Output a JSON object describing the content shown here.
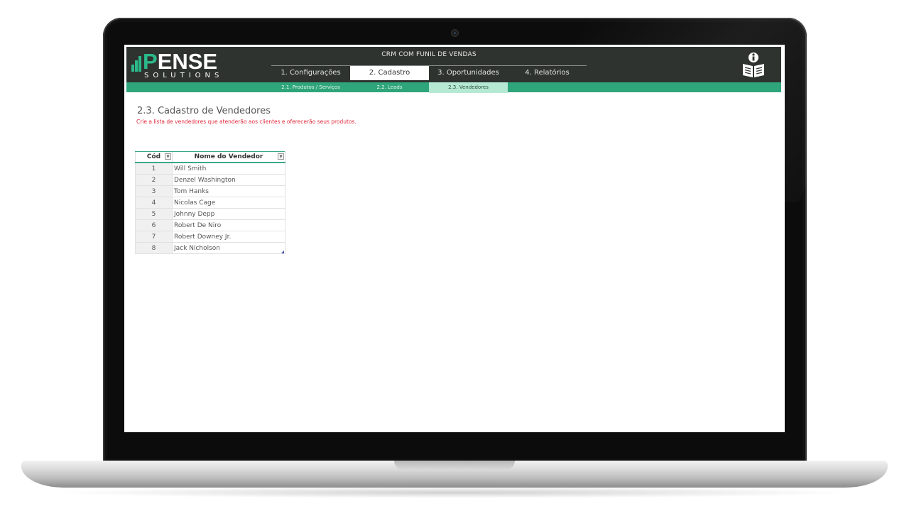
{
  "header": {
    "logo_word": "ENSE",
    "logo_initial": "P",
    "logo_sub": "SOLUTIONS",
    "app_title": "CRM COM FUNIL DE VENDAS",
    "tabs": [
      {
        "label": "1. Configurações"
      },
      {
        "label": "2. Cadastro"
      },
      {
        "label": "3. Oportunidades"
      },
      {
        "label": "4. Relatórios"
      }
    ],
    "active_tab": "2. Cadastro"
  },
  "subnav": {
    "tabs": [
      {
        "label": "2.1. Produtos / Serviços"
      },
      {
        "label": "2.2. Leads"
      },
      {
        "label": "2.3. Vendedores"
      }
    ],
    "active_tab": "2.3. Vendedores"
  },
  "main": {
    "title": "2.3. Cadastro de Vendedores",
    "subtitle": "Crie a lista de vendedores que atenderão aos clientes e oferecerão seus produtos."
  },
  "table": {
    "columns": [
      "Cód",
      "Nome do Vendedor"
    ],
    "rows": [
      {
        "cod": "1",
        "nome": "Will Smith"
      },
      {
        "cod": "2",
        "nome": "Denzel Washington"
      },
      {
        "cod": "3",
        "nome": "Tom Hanks"
      },
      {
        "cod": "4",
        "nome": "Nicolas Cage"
      },
      {
        "cod": "5",
        "nome": "Johnny Depp"
      },
      {
        "cod": "6",
        "nome": "Robert De Niro"
      },
      {
        "cod": "7",
        "nome": "Robert Downey Jr."
      },
      {
        "cod": "8",
        "nome": "Jack Nicholson"
      }
    ]
  },
  "icons": {
    "info": "info-book-icon",
    "filter": "filter-dropdown-icon"
  },
  "colors": {
    "header_bg": "#2e3330",
    "accent_green": "#2fa57b",
    "active_subtab": "#b6e9d3",
    "subtitle_red": "#e0293a"
  }
}
